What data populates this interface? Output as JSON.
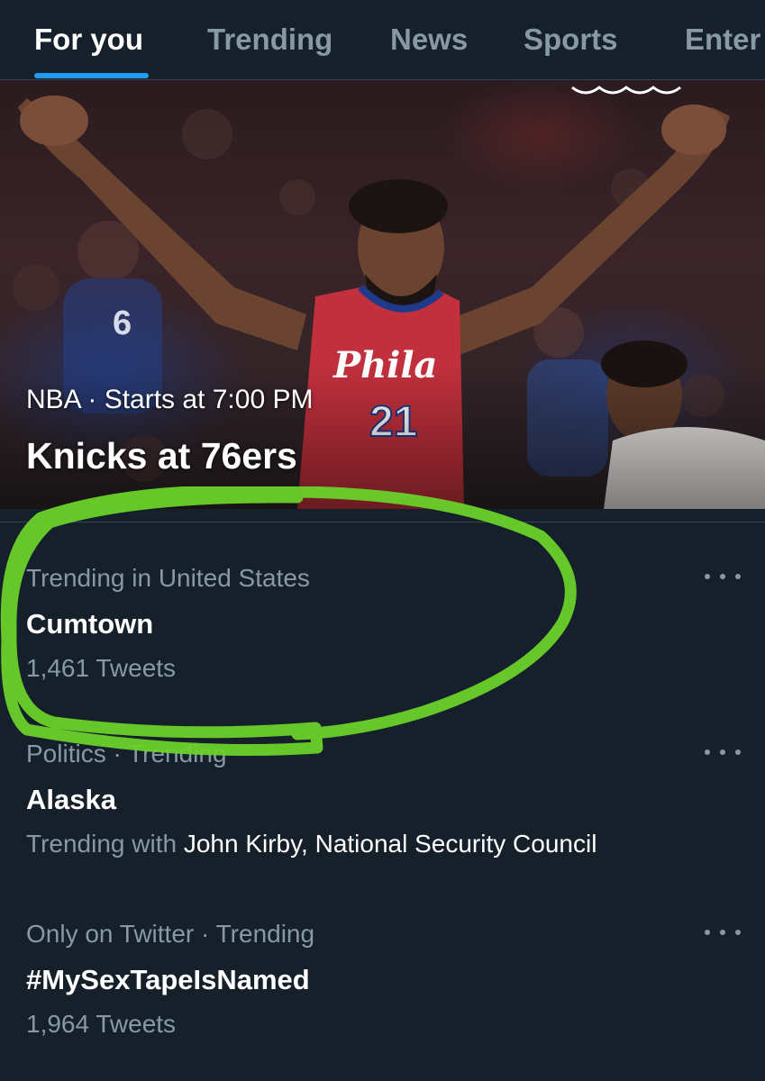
{
  "tabs": [
    {
      "label": "For you",
      "active": true
    },
    {
      "label": "Trending",
      "active": false
    },
    {
      "label": "News",
      "active": false
    },
    {
      "label": "Sports",
      "active": false
    },
    {
      "label": "Enter",
      "active": false
    }
  ],
  "hero": {
    "subtitle": "NBA · Starts at 7:00 PM",
    "title": "Knicks at 76ers",
    "jersey_text": "Phila",
    "jersey_number": "21",
    "crowd_number": "6"
  },
  "trends": [
    {
      "meta": "Trending in United States",
      "name": "Cumtown",
      "count": "1,461 Tweets"
    },
    {
      "meta": "Politics · Trending",
      "name": "Alaska",
      "count_prefix": "Trending with ",
      "count_names": "John Kirby, National Security Council"
    },
    {
      "meta": "Only on Twitter · Trending",
      "name": "#MySexTapeIsNamed",
      "count": "1,964 Tweets"
    }
  ],
  "icons": {
    "more": "more-horizontal-icon"
  },
  "colors": {
    "background": "#15202b",
    "accent": "#1d9bf0",
    "muted_text": "#8899a6",
    "highlight": "#6ad12a"
  }
}
